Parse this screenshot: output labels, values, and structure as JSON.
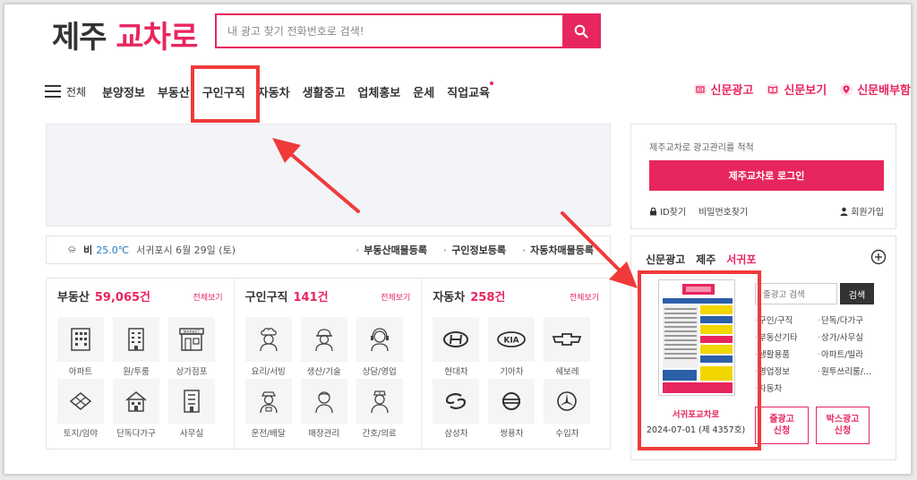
{
  "header": {
    "logo_part1": "제주",
    "logo_part2": "교차로",
    "search_placeholder": "내 광고 찾기 전화번호로 검색!"
  },
  "nav": {
    "all_label": "전체",
    "items": [
      "분양정보",
      "부동산",
      "구인구직",
      "자동차",
      "생활중고",
      "업체홍보",
      "운세",
      "직업교육"
    ],
    "right_links": [
      "신문광고",
      "신문보기",
      "신문배부함"
    ]
  },
  "weather": {
    "condition": "비",
    "temp": "25.0℃",
    "date": "서귀포시 6월 29일 (토)",
    "register_links": [
      "부동산매물등록",
      "구인정보등록",
      "자동차매물등록"
    ]
  },
  "categories": {
    "more_label": "전체보기",
    "realestate": {
      "title": "부동산",
      "count": "59,065건",
      "items": [
        "아파트",
        "원/투룸",
        "상가점포",
        "토지/임야",
        "단독다가구",
        "사무실"
      ]
    },
    "jobs": {
      "title": "구인구직",
      "count": "141건",
      "items": [
        "요리/서빙",
        "생산/기술",
        "상담/영업",
        "운전/배달",
        "매장관리",
        "간호/의료"
      ]
    },
    "cars": {
      "title": "자동차",
      "count": "258건",
      "items": [
        "현대차",
        "기아차",
        "쉐보레",
        "삼성차",
        "쌍용차",
        "수입차"
      ]
    }
  },
  "login": {
    "message": "제주교차로 광고관리를 척척",
    "button": "제주교차로 로그인",
    "find_id": "ID찾기",
    "find_pw": "비밀번호찾기",
    "signup": "회원가입"
  },
  "newspaper": {
    "tab_main": "신문광고",
    "tab_jeju": "제주",
    "tab_seogwipo": "서귀포",
    "paper_title": "서귀포교차로",
    "paper_date": "2024-07-01 (제 4357호)",
    "search_placeholder": "줄광고 검색",
    "search_button": "검색",
    "list": [
      "구인/구직",
      "단독/다가구",
      "부동산기타",
      "상가/사무실",
      "생활용품",
      "아파트/빌라",
      "영업정보",
      "원투쓰리룸/...",
      "자동차"
    ],
    "line_ad_button": "줄광고 신청",
    "box_ad_button": "박스광고 신청"
  },
  "colors": {
    "brand": "#e8265e",
    "highlight": "#f03a3a"
  }
}
